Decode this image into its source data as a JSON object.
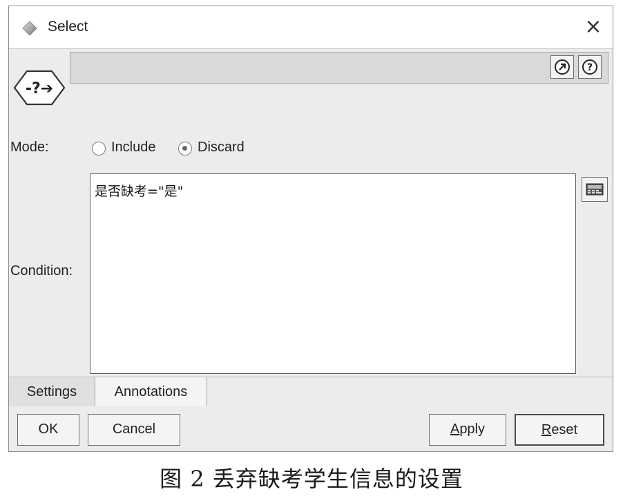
{
  "window": {
    "title": "Select",
    "close_glyph": "×",
    "title_icon": "diamond-icon",
    "node_icon": "select-node-icon"
  },
  "header": {
    "node_name_value": "",
    "help_buttons": [
      "goto-stream-icon",
      "help-icon"
    ]
  },
  "mode": {
    "label": "Mode:",
    "options": [
      {
        "label": "Include",
        "selected": false
      },
      {
        "label": "Discard",
        "selected": true
      }
    ]
  },
  "condition": {
    "label": "Condition:",
    "value": "是否缺考=\"是\"",
    "builder_icon": "expression-builder-icon"
  },
  "tabs": [
    {
      "label": "Settings",
      "active": true
    },
    {
      "label": "Annotations",
      "active": false
    }
  ],
  "buttons": {
    "ok": "OK",
    "cancel": "Cancel",
    "apply_mnemonic": "A",
    "apply_rest": "pply",
    "reset_mnemonic": "R",
    "reset_rest": "eset"
  },
  "caption": "图 2   丢弃缺考学生信息的设置"
}
